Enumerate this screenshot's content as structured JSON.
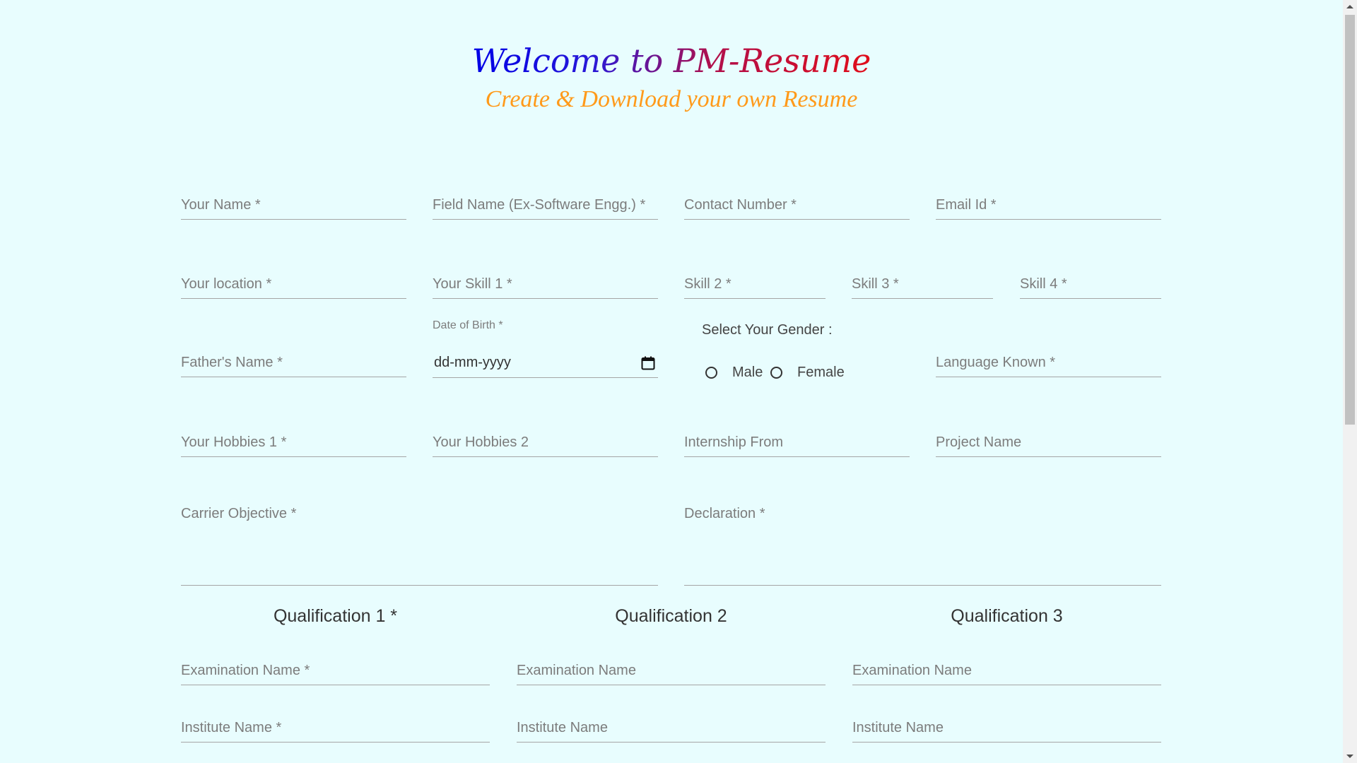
{
  "header": {
    "title": "Welcome to PM-Resume",
    "subtitle": "Create & Download your own Resume"
  },
  "form": {
    "row1": {
      "name": "Your Name *",
      "field_name": "Field Name (Ex-Software Engg.) *",
      "contact": "Contact Number *",
      "email": "Email Id *"
    },
    "row2": {
      "location": "Your location *",
      "skill1": "Your Skill 1 *",
      "skill2": "Skill 2 *",
      "skill3": "Skill 3 *",
      "skill4": "Skill 4 *"
    },
    "row3": {
      "father_name": "Father's Name *",
      "dob_label": "Date of Birth *",
      "dob_value": "dd-mm-yyyy",
      "gender_label": "Select Your Gender :",
      "gender_options": [
        "Male",
        "Female"
      ],
      "language": "Language Known *"
    },
    "row4": {
      "hobbies1": "Your Hobbies 1 *",
      "hobbies2": "Your Hobbies 2",
      "internship": "Internship From",
      "project": "Project Name"
    },
    "row5": {
      "objective": "Carrier Objective *",
      "declaration": "Declaration *"
    },
    "qualifications": [
      {
        "heading": "Qualification 1 *",
        "exam": "Examination Name *",
        "institute": "Institute Name *"
      },
      {
        "heading": "Qualification 2",
        "exam": "Examination Name",
        "institute": "Institute Name"
      },
      {
        "heading": "Qualification 3",
        "exam": "Examination Name",
        "institute": "Institute Name"
      }
    ]
  },
  "icons": {
    "date_picker": "calendar-icon"
  }
}
